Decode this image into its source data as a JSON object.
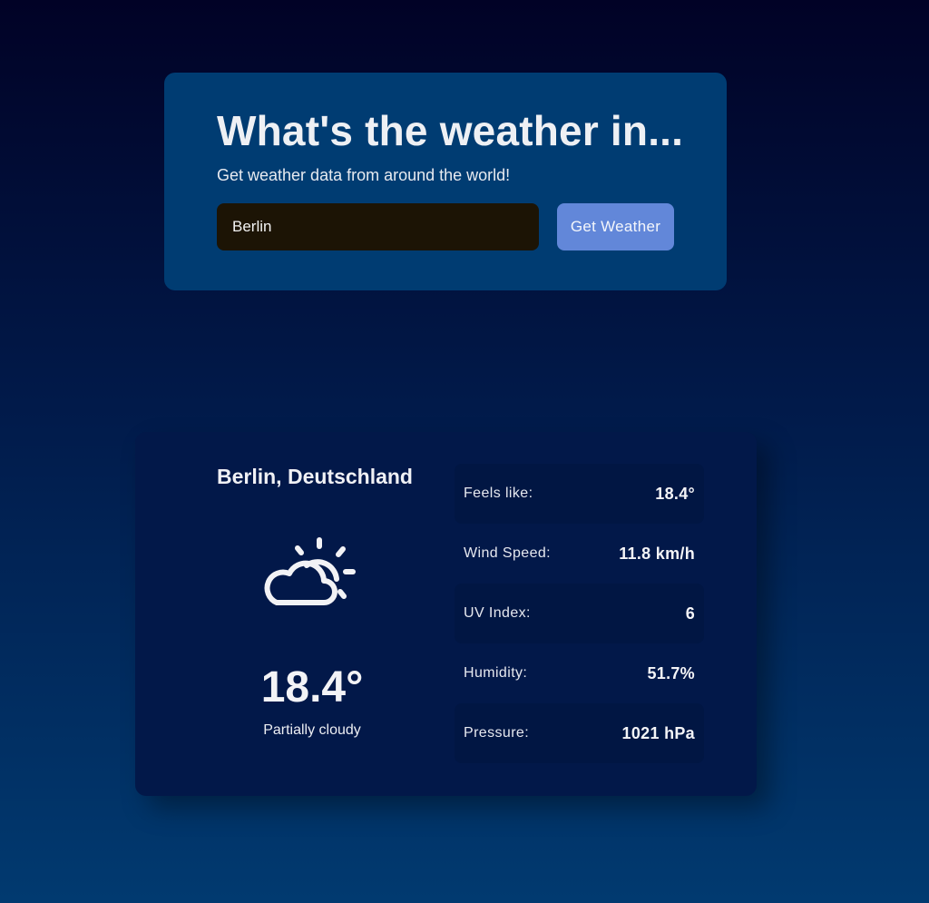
{
  "search": {
    "title": "What's the weather in...",
    "subtitle": "Get weather data from around the world!",
    "city_value": "Berlin",
    "button_label": "Get Weather"
  },
  "weather": {
    "location": "Berlin, Deutschland",
    "icon": "partly-cloudy-icon",
    "temperature": "18.4°",
    "condition": "Partially cloudy",
    "stats": [
      {
        "label": "Feels like:",
        "value": "18.4°"
      },
      {
        "label": "Wind Speed:",
        "value": "11.8 km/h"
      },
      {
        "label": "UV Index:",
        "value": "6"
      },
      {
        "label": "Humidity:",
        "value": "51.7%"
      },
      {
        "label": "Pressure:",
        "value": "1021 hPa"
      }
    ]
  },
  "colors": {
    "search_card_bg": "#003c72",
    "weather_card_bg": "#021849",
    "button_bg": "#6287d9",
    "input_bg": "#1c1405"
  }
}
